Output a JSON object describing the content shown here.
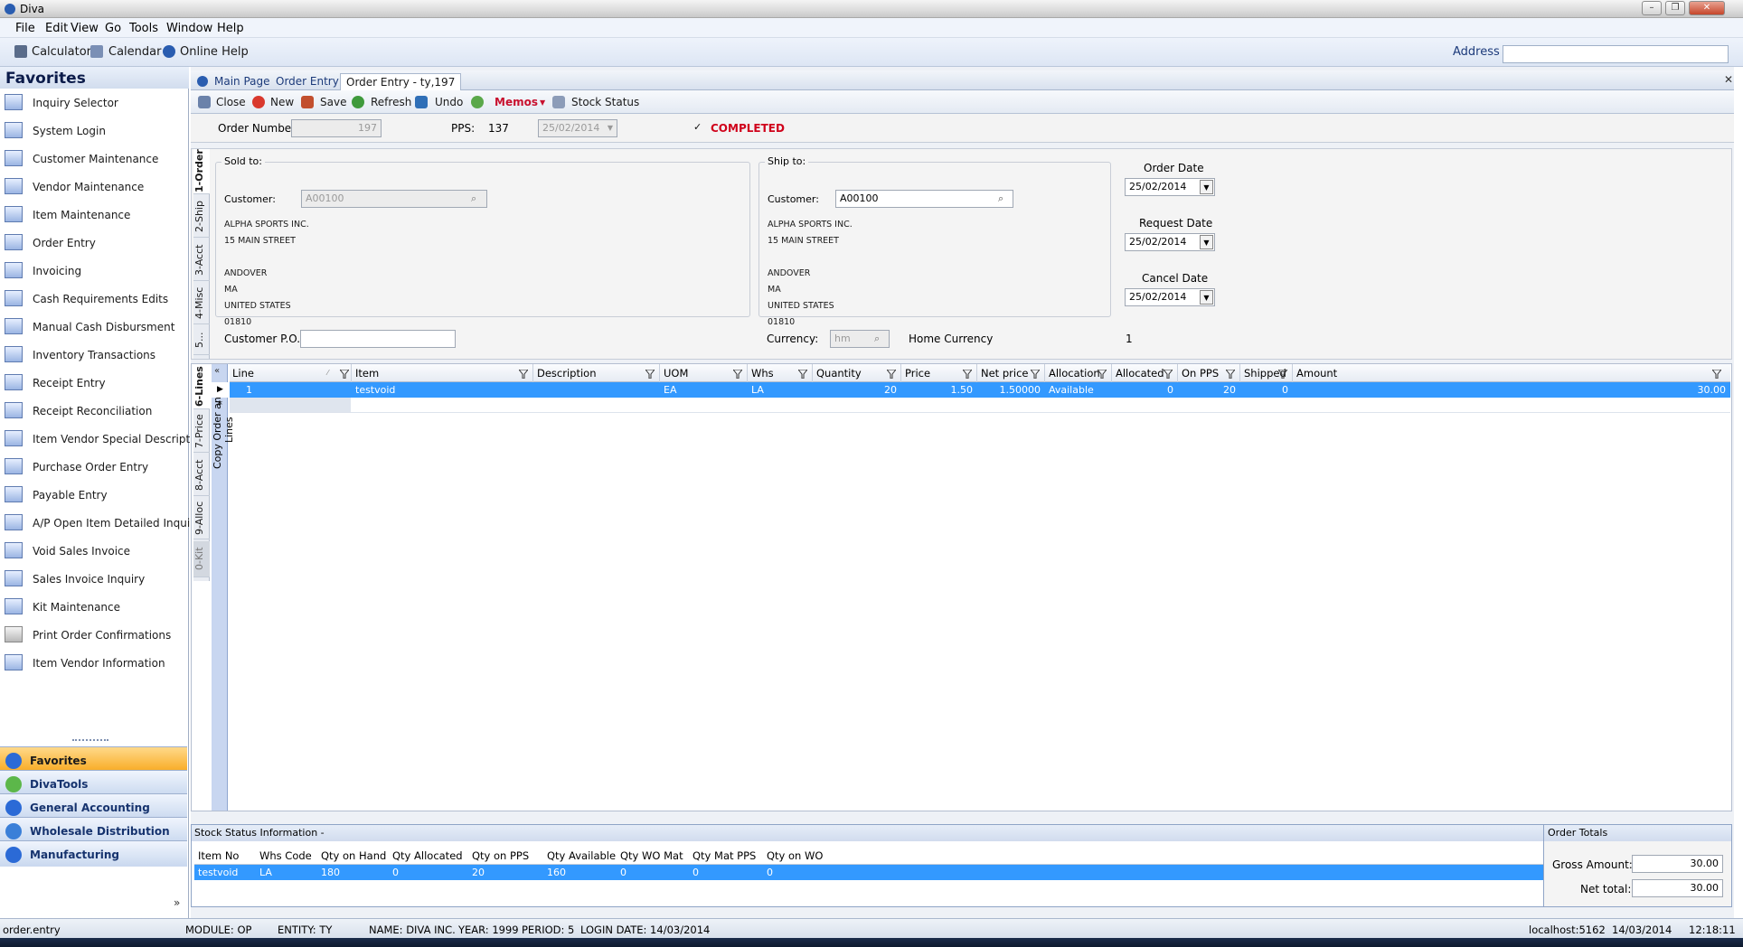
{
  "window": {
    "title": "Diva",
    "minimize": "–",
    "restore": "❐",
    "close": "✕"
  },
  "menu": [
    "File",
    "Edit",
    "View",
    "Go",
    "Tools",
    "Window",
    "Help"
  ],
  "toolbar": {
    "calculator": "Calculator",
    "calendar": "Calendar",
    "online_help": "Online Help",
    "address_label": "Address",
    "address_value": ""
  },
  "sidebar": {
    "title": "Favorites",
    "items": [
      "Inquiry Selector",
      "System Login",
      "Customer Maintenance",
      "Vendor Maintenance",
      "Item Maintenance",
      "Order Entry",
      "Invoicing",
      "Cash Requirements Edits",
      "Manual Cash Disbursment",
      "Inventory Transactions",
      "Receipt Entry",
      "Receipt Reconciliation",
      "Item Vendor Special Description",
      "Purchase Order Entry",
      "Payable Entry",
      "A/P Open Item Detailed Inquiry",
      "Void Sales Invoice",
      "Sales Invoice Inquiry",
      "Kit Maintenance",
      "Print Order Confirmations",
      "Item Vendor Information"
    ],
    "nav": [
      "Favorites",
      "DivaTools",
      "General Accounting",
      "Wholesale Distribution",
      "Manufacturing"
    ]
  },
  "tabs": {
    "main": "Main Page",
    "order": "Order Entry",
    "active": "Order Entry - ty,197",
    "close": "✕"
  },
  "actions": {
    "close": "Close",
    "new": "New",
    "save": "Save",
    "refresh": "Refresh",
    "undo": "Undo",
    "memos": "Memos",
    "stock_status": "Stock Status"
  },
  "order": {
    "number_label": "Order Number:",
    "number": "197",
    "pps_label": "PPS:",
    "pps": "137",
    "pps_date": "25/02/2014",
    "completed_mark": "✓",
    "completed": "COMPLETED",
    "vtabs": [
      "1-Order",
      "2-Ship",
      "3-Acct",
      "4-Misc",
      "5..."
    ],
    "sold_to": {
      "title": "Sold to:",
      "customer_label": "Customer:",
      "customer": "A00100",
      "lines": [
        "ALPHA SPORTS INC.",
        "15 MAIN STREET",
        "",
        "ANDOVER",
        "MA",
        "UNITED STATES",
        "01810"
      ]
    },
    "ship_to": {
      "title": "Ship to:",
      "customer_label": "Customer:",
      "customer": "A00100",
      "lines": [
        "ALPHA SPORTS INC.",
        "15 MAIN STREET",
        "",
        "ANDOVER",
        "MA",
        "UNITED STATES",
        "01810"
      ]
    },
    "customer_po_label": "Customer P.O.:",
    "customer_po": "",
    "currency_label": "Currency:",
    "currency": "hm",
    "home_currency_label": "Home Currency",
    "rate": "1",
    "dates": {
      "order_label": "Order Date",
      "order": "25/02/2014",
      "request_label": "Request Date",
      "request": "25/02/2014",
      "cancel_label": "Cancel Date",
      "cancel": "25/02/2014"
    }
  },
  "lines": {
    "vtabs": [
      "6-Lines",
      "7-Price",
      "8-Acct",
      "9-Alloc",
      "0-Kit"
    ],
    "side_label": "Copy Order and Lines",
    "columns": [
      "Line",
      "Item",
      "Description",
      "UOM",
      "Whs",
      "Quantity",
      "Price",
      "Net price",
      "Allocation",
      "Allocated",
      "On PPS",
      "Shipped",
      "Amount"
    ],
    "rows": [
      {
        "line": "1",
        "item": "testvoid",
        "description": "",
        "uom": "EA",
        "whs": "LA",
        "quantity": "20",
        "price": "1.50",
        "net_price": "1.50000",
        "allocation": "Available",
        "allocated": "0",
        "on_pps": "20",
        "shipped": "0",
        "amount": "30.00"
      }
    ],
    "new_row_marker": "*"
  },
  "stock": {
    "title": "Stock Status Information -",
    "columns": [
      "Item No",
      "Whs Code",
      "Qty on Hand",
      "Qty Allocated",
      "Qty on PPS",
      "Qty Available",
      "Qty WO Mat",
      "Qty Mat PPS",
      "Qty on WO"
    ],
    "row": [
      "testvoid",
      "LA",
      "180",
      "0",
      "20",
      "160",
      "0",
      "0",
      "0"
    ]
  },
  "totals": {
    "title": "Order Totals",
    "gross_label": "Gross Amount:",
    "gross": "30.00",
    "net_label": "Net total:",
    "net": "30.00"
  },
  "status": {
    "screen": "order.entry",
    "module": "MODULE: OP",
    "entity": "ENTITY: TY",
    "name": "NAME: DIVA INC.",
    "year": "YEAR: 1999",
    "period": "PERIOD: 5",
    "login": "LOGIN DATE: 14/03/2014",
    "host": "localhost:5162",
    "date": "14/03/2014",
    "time": "12:18:11"
  }
}
